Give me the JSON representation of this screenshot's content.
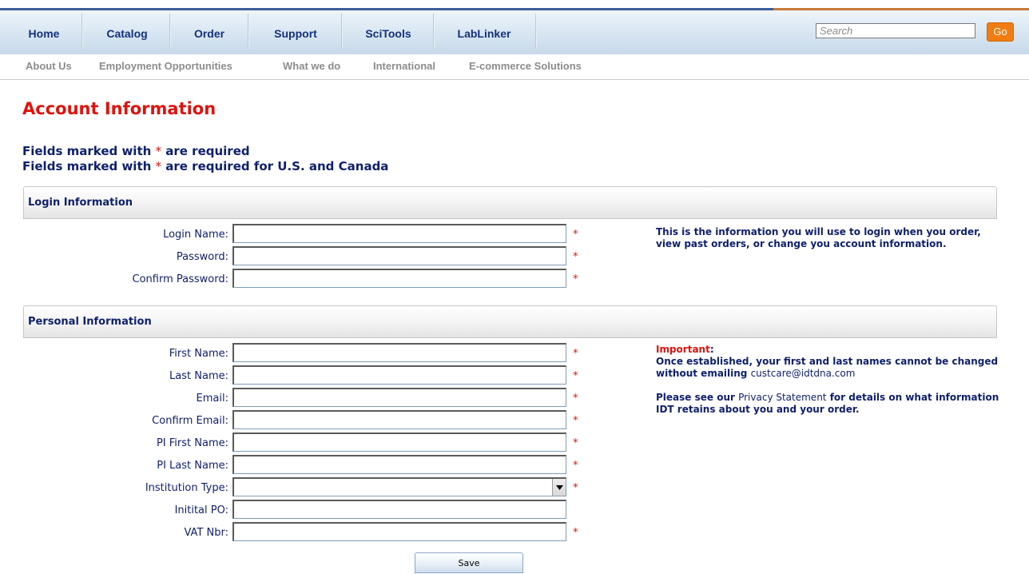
{
  "nav": {
    "items": [
      {
        "label": "Home"
      },
      {
        "label": "Catalog"
      },
      {
        "label": "Order"
      },
      {
        "label": "Support"
      },
      {
        "label": "SciTools"
      },
      {
        "label": "LabLinker"
      }
    ],
    "search_placeholder": "Search",
    "search_button": "Go"
  },
  "subnav": {
    "items": [
      {
        "label": "About Us"
      },
      {
        "label": "Employment Opportunities"
      },
      {
        "label": "What we do"
      },
      {
        "label": "International"
      },
      {
        "label": "E-commerce Solutions"
      }
    ]
  },
  "page": {
    "title": "Account Information",
    "required_prefix": "Fields marked with ",
    "required_star": "*",
    "required_suffix_1": " are required",
    "required_suffix_2": " are required for U.S. and Canada"
  },
  "login_section": {
    "heading": "Login Information",
    "fields": [
      {
        "label": "Login Name:",
        "value": "",
        "required": "*"
      },
      {
        "label": "Password:",
        "value": "",
        "required": "*"
      },
      {
        "label": "Confirm Password:",
        "value": "",
        "required": "*"
      }
    ],
    "help_text": "This is the information you will use to login when you order, view past orders, or change you account information."
  },
  "personal_section": {
    "heading": "Personal Information",
    "fields": [
      {
        "label": "First Name:",
        "value": "",
        "required": "*"
      },
      {
        "label": "Last Name:",
        "value": "",
        "required": "*"
      },
      {
        "label": "Email:",
        "value": "",
        "required": "*"
      },
      {
        "label": "Confirm Email:",
        "value": "",
        "required": "*"
      },
      {
        "label": "PI First Name:",
        "value": "",
        "required": "*"
      },
      {
        "label": "PI Last Name:",
        "value": "",
        "required": "*"
      },
      {
        "label": "Institution Type:",
        "value": "",
        "required": "*"
      },
      {
        "label": "Initital PO:",
        "value": ""
      },
      {
        "label": "VAT Nbr:",
        "value": "",
        "required": "*"
      }
    ],
    "important_label": "Important",
    "important_colon": ":",
    "important_text": "Once established, your first and last names cannot be changed without emailing ",
    "important_email": "custcare@idtdna.com",
    "privacy_prefix": "Please see our ",
    "privacy_link": "Privacy Statement",
    "privacy_suffix": " for details on what information IDT retains about you and your order."
  },
  "actions": {
    "save_label": "Save"
  },
  "colors": {
    "nav_text": "#14317e",
    "title_red": "#e0120c",
    "label_navy": "#0e1f6e",
    "go_orange": "#f07c12"
  }
}
